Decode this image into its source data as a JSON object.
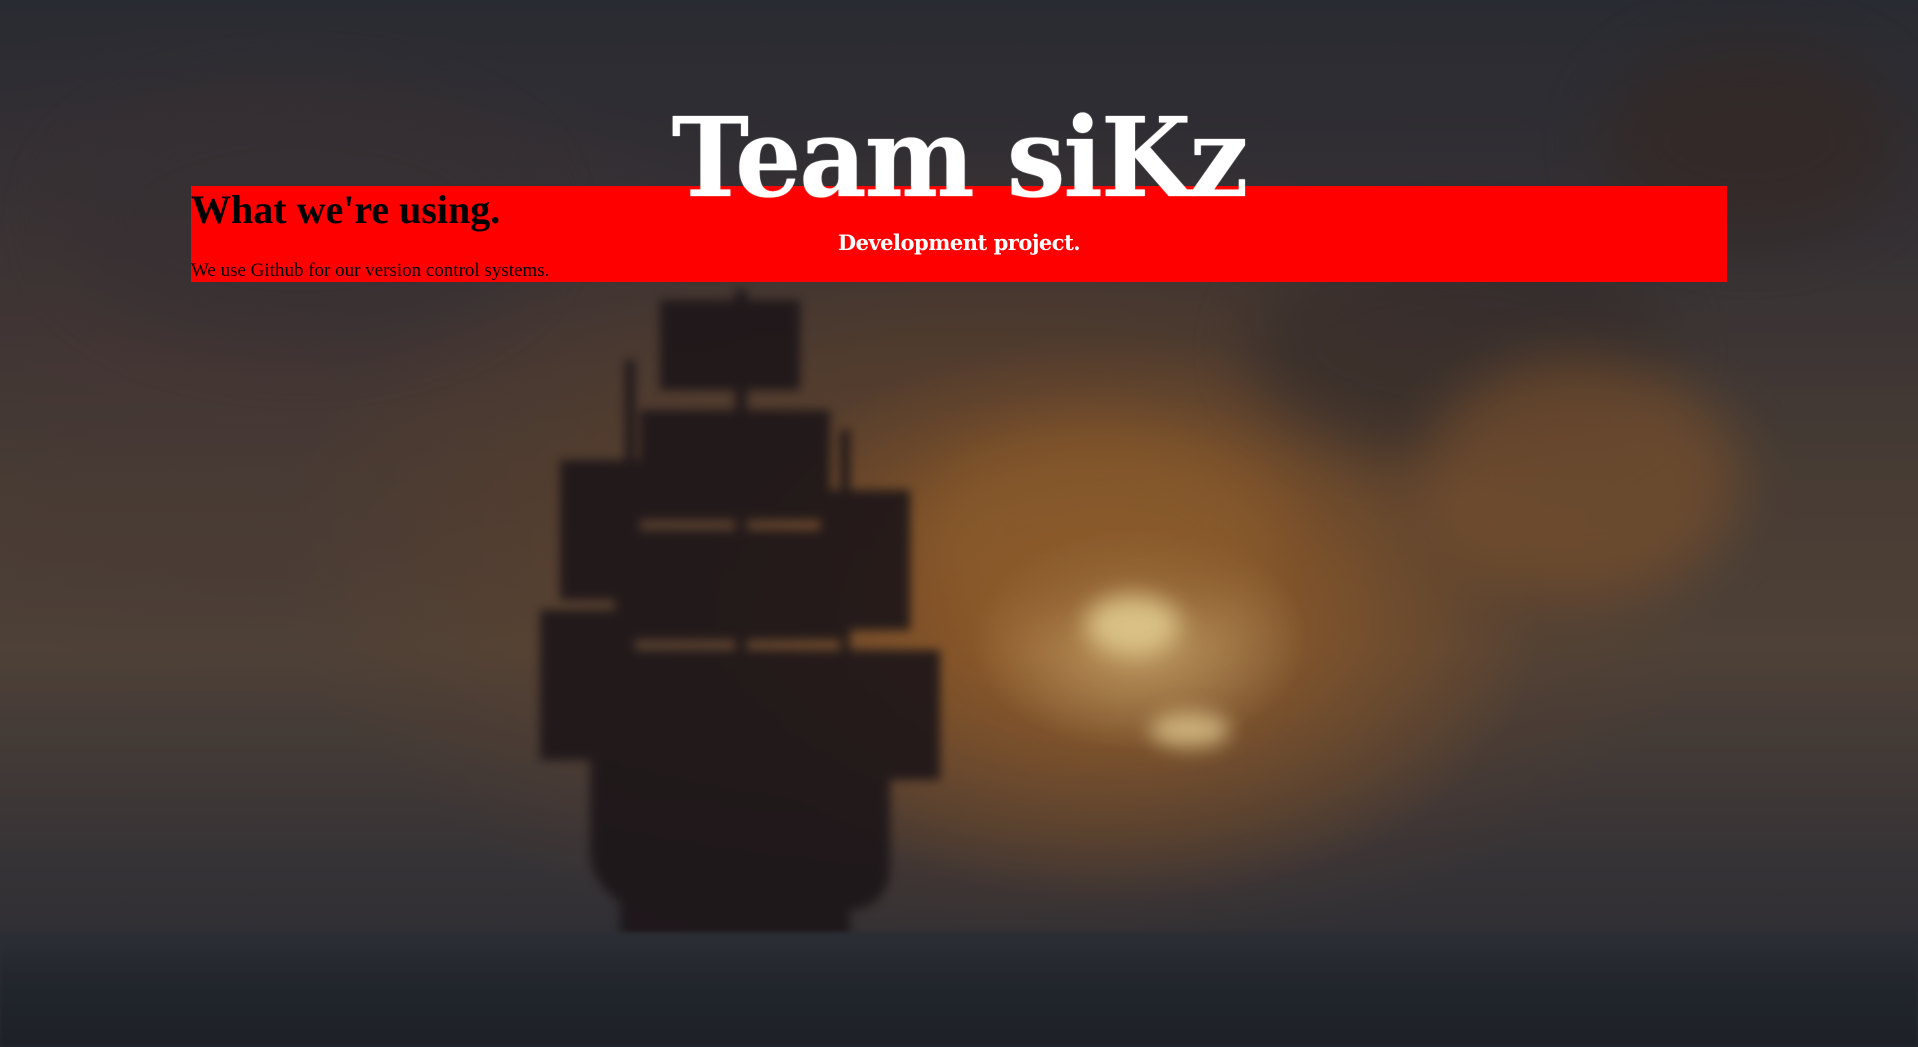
{
  "header": {
    "title": "Team siKz",
    "subtitle": "Development project."
  },
  "section": {
    "heading": "What we're using.",
    "text": "We use Github for our version control systems."
  },
  "colors": {
    "section_background": "#ff0000",
    "heading_text": "#000000",
    "logo_text": "#ffffff"
  },
  "background": {
    "image_subject": "pirate-ship-at-sunset"
  }
}
